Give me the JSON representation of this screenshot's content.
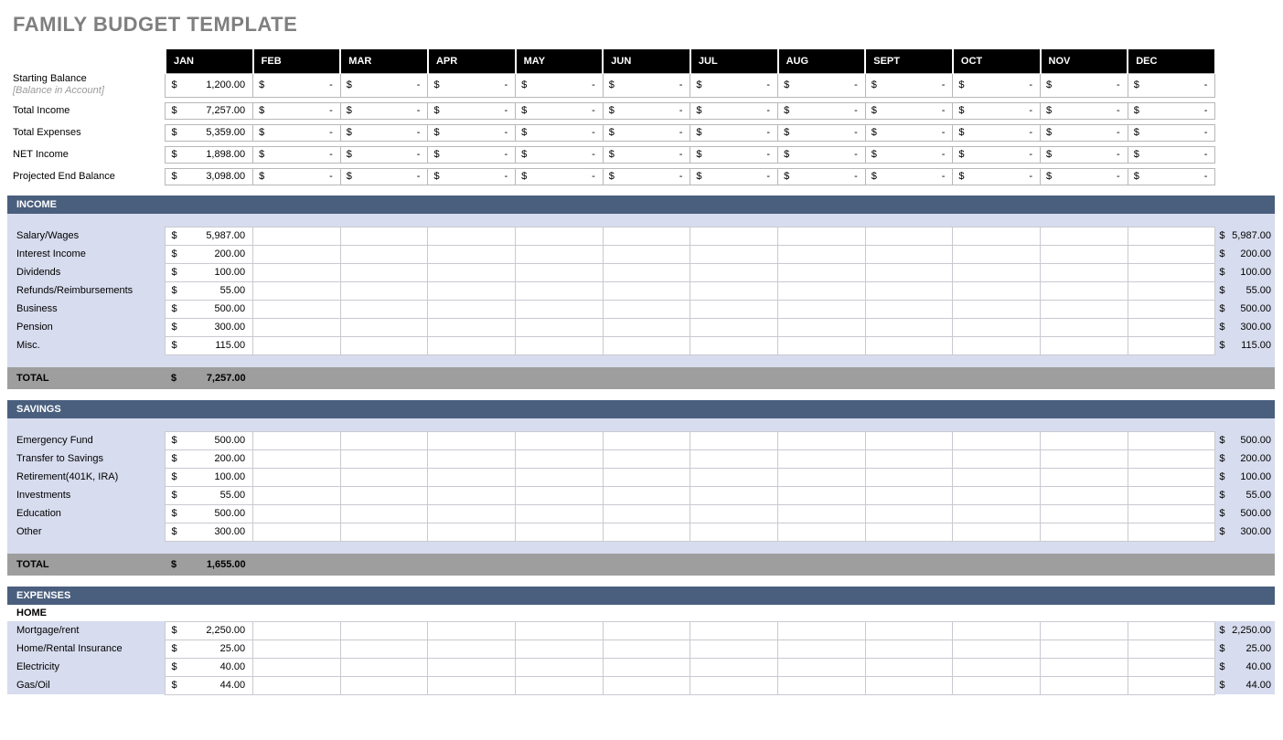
{
  "title": "FAMILY BUDGET TEMPLATE",
  "months": [
    "JAN",
    "FEB",
    "MAR",
    "APR",
    "MAY",
    "JUN",
    "JUL",
    "AUG",
    "SEPT",
    "OCT",
    "NOV",
    "DEC"
  ],
  "summary": {
    "starting_balance_label": "Starting Balance",
    "balance_in_account_label": "[Balance in Account]",
    "total_income_label": "Total Income",
    "total_expenses_label": "Total Expenses",
    "net_income_label": "NET Income",
    "projected_end_label": "Projected End Balance",
    "starting_balance": "1,200.00",
    "total_income": "7,257.00",
    "total_expenses": "5,359.00",
    "net_income": "1,898.00",
    "projected_end": "3,098.00"
  },
  "sections": {
    "income": {
      "title": "INCOME",
      "total_label": "TOTAL",
      "total": "7,257.00",
      "rows": [
        {
          "label": "Salary/Wages",
          "jan": "5,987.00",
          "total": "5,987.00"
        },
        {
          "label": "Interest Income",
          "jan": "200.00",
          "total": "200.00"
        },
        {
          "label": "Dividends",
          "jan": "100.00",
          "total": "100.00"
        },
        {
          "label": "Refunds/Reimbursements",
          "jan": "55.00",
          "total": "55.00"
        },
        {
          "label": "Business",
          "jan": "500.00",
          "total": "500.00"
        },
        {
          "label": "Pension",
          "jan": "300.00",
          "total": "300.00"
        },
        {
          "label": "Misc.",
          "jan": "115.00",
          "total": "115.00"
        }
      ]
    },
    "savings": {
      "title": "SAVINGS",
      "total_label": "TOTAL",
      "total": "1,655.00",
      "rows": [
        {
          "label": "Emergency Fund",
          "jan": "500.00",
          "total": "500.00"
        },
        {
          "label": "Transfer to Savings",
          "jan": "200.00",
          "total": "200.00"
        },
        {
          "label": "Retirement(401K, IRA)",
          "jan": "100.00",
          "total": "100.00"
        },
        {
          "label": "Investments",
          "jan": "55.00",
          "total": "55.00"
        },
        {
          "label": "Education",
          "jan": "500.00",
          "total": "500.00"
        },
        {
          "label": "Other",
          "jan": "300.00",
          "total": "300.00"
        }
      ]
    },
    "expenses": {
      "title": "EXPENSES",
      "sub_title": "HOME",
      "rows": [
        {
          "label": "Mortgage/rent",
          "jan": "2,250.00",
          "total": "2,250.00"
        },
        {
          "label": "Home/Rental Insurance",
          "jan": "25.00",
          "total": "25.00"
        },
        {
          "label": "Electricity",
          "jan": "40.00",
          "total": "40.00"
        },
        {
          "label": "Gas/Oil",
          "jan": "44.00",
          "total": "44.00"
        }
      ]
    }
  },
  "dash": "-",
  "currency": "$"
}
